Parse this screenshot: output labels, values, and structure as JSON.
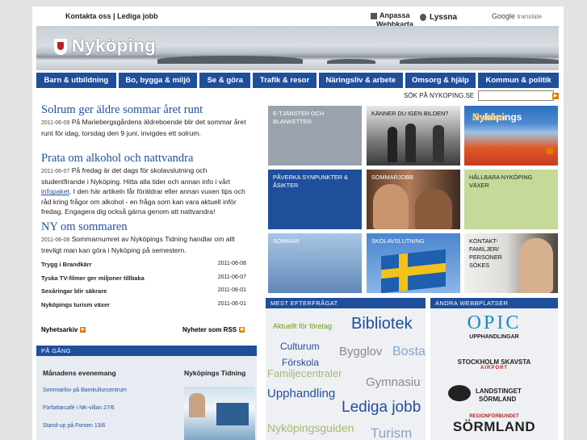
{
  "header": {
    "contact": "Kontakta oss",
    "sep": "|",
    "jobs": "Lediga jobb",
    "adapt": "Anpassa",
    "webmap": "Webbkarta",
    "listen": "Lyssna",
    "google": "Google",
    "translate": "translate"
  },
  "logo": "Nyköping",
  "nav": [
    "Barn & utbildning",
    "Bo, bygga & miljö",
    "Se & göra",
    "Trafik & resor",
    "Näringsliv & arbete",
    "Omsorg & hjälp",
    "Kommun & politik"
  ],
  "search": {
    "label": "SÖK PÅ NYKOPING.SE",
    "value": ""
  },
  "news": [
    {
      "title": "Solrum ger äldre sommar året runt",
      "date": "2011-06-09",
      "text": "På Mariebergsgårdens äldreboende blir det sommar året runt för idag, torsdag den 9 juni, invigdes ett solrum."
    },
    {
      "title": "Prata om alkohol och nattvandra",
      "date": "2011-06-07",
      "text1": "På fredag är det dags för skolavslutning och studentfirande i Nyköping. Hitta alla tider och annan info i vårt",
      "link": "infopaket",
      "text2": ". I den här artikeln får föräldrar eller annan vuxen tips och råd kring frågor om alkohol - en fråga som kan vara aktuell inför fredag. Engagera dig också gärna genom att nattvandra!"
    },
    {
      "title": "NY om sommaren",
      "date": "2011-06-08",
      "text": "Sommarnumret av Nyköpings Tidning handlar om allt trevligt man kan göra i Nyköping på semestern."
    }
  ],
  "short_news": [
    {
      "title": "Trygg i Brandkärr",
      "date": "2011-06-08"
    },
    {
      "title": "Tyska TV-filmer ger miljoner tillbaka",
      "date": "2011-06-07"
    },
    {
      "title": "Sexåringar blir säkrare",
      "date": "2011-06-01"
    },
    {
      "title": "Nyköpings turism växer",
      "date": "2011-06-01"
    }
  ],
  "archive": "Nyhetsarkiv",
  "rss": "Nyheter som RSS",
  "pa_gang": {
    "bar": "PÅ GÅNG",
    "events_title": "Månadens evenemang",
    "events": [
      "Sommarlov på Bamkulturcentrum",
      "Författarcafé i NK-villan 27/6",
      "Stand-up på Forsen 13/6"
    ],
    "paper_title": "Nyköpings Tidning"
  },
  "tiles": [
    {
      "label": "E-TJÄNSTER OCH BLANKETTER"
    },
    {
      "label": "KÄNNER DU IGEN BILDEN?"
    },
    {
      "label": "Nyköpings",
      "label2": "Guiden"
    },
    {
      "label": "PÅVERKA SYNPUNKTER & ÅSIKTER"
    },
    {
      "label": "SOMMARJOBB"
    },
    {
      "label": "HÅLLBARA NYKÖPING VÄXER"
    },
    {
      "label": "SOMMAR"
    },
    {
      "label": "SKOLAVSLUTNING"
    },
    {
      "label": "KONTAKT- FAMILJER/ PERSONER SÖKES"
    }
  ],
  "most_wanted": {
    "bar": "MEST EFTERFRÅGAT",
    "words": [
      "Aktuellt för företag",
      "Bibliotek",
      "Culturum",
      "Bygglov",
      "Bosta",
      "Förskola",
      "Familjecentraler",
      "Gymnasiu",
      "Upphandling",
      "Lediga jobb",
      "Nyköpingsguiden",
      "Turism"
    ]
  },
  "other_sites": {
    "bar": "ANDRA WEBBPLATSER",
    "opic": "OPIC",
    "opic_sub": "UPPHANDLINGAR",
    "skavsta": "STOCKHOLM SKAVSTA",
    "skavsta_sub": "AIRPORT",
    "landsting1": "LANDSTINGET",
    "landsting2": "SÖRMLAND",
    "region1": "REGIONFÖRBUNDET",
    "region2": "SÖRMLAND"
  },
  "colors": {
    "brand_blue": "#1f4f9b",
    "accent_orange": "#e07b00",
    "tile_gray": "#9aa3ad",
    "tile_blue": "#1f4f9b",
    "tile_green": "#c5d998"
  }
}
